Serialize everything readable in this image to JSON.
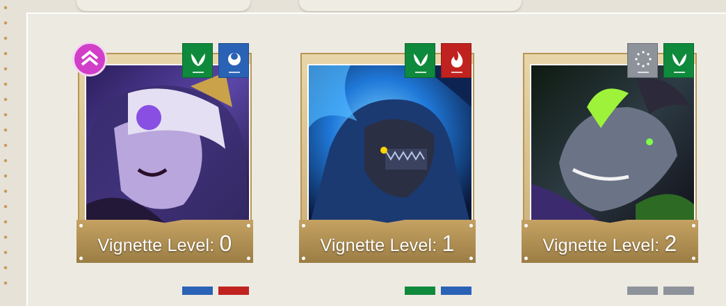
{
  "cards": [
    {
      "label": "Vignette Level:",
      "level": "0",
      "badges": [
        "leaf-icon",
        "moon-icon"
      ],
      "up": true
    },
    {
      "label": "Vignette Level:",
      "level": "1",
      "badges": [
        "leaf-icon",
        "fire-icon"
      ],
      "up": false
    },
    {
      "label": "Vignette Level:",
      "level": "2",
      "badges": [
        "stars-icon",
        "leaf-icon"
      ],
      "up": false
    }
  ],
  "colors": {
    "leaf": "#0f8a3c",
    "moon": "#2a62b6",
    "fire": "#c0231f",
    "stars": "#8e939b",
    "up": "#d13fc9"
  }
}
